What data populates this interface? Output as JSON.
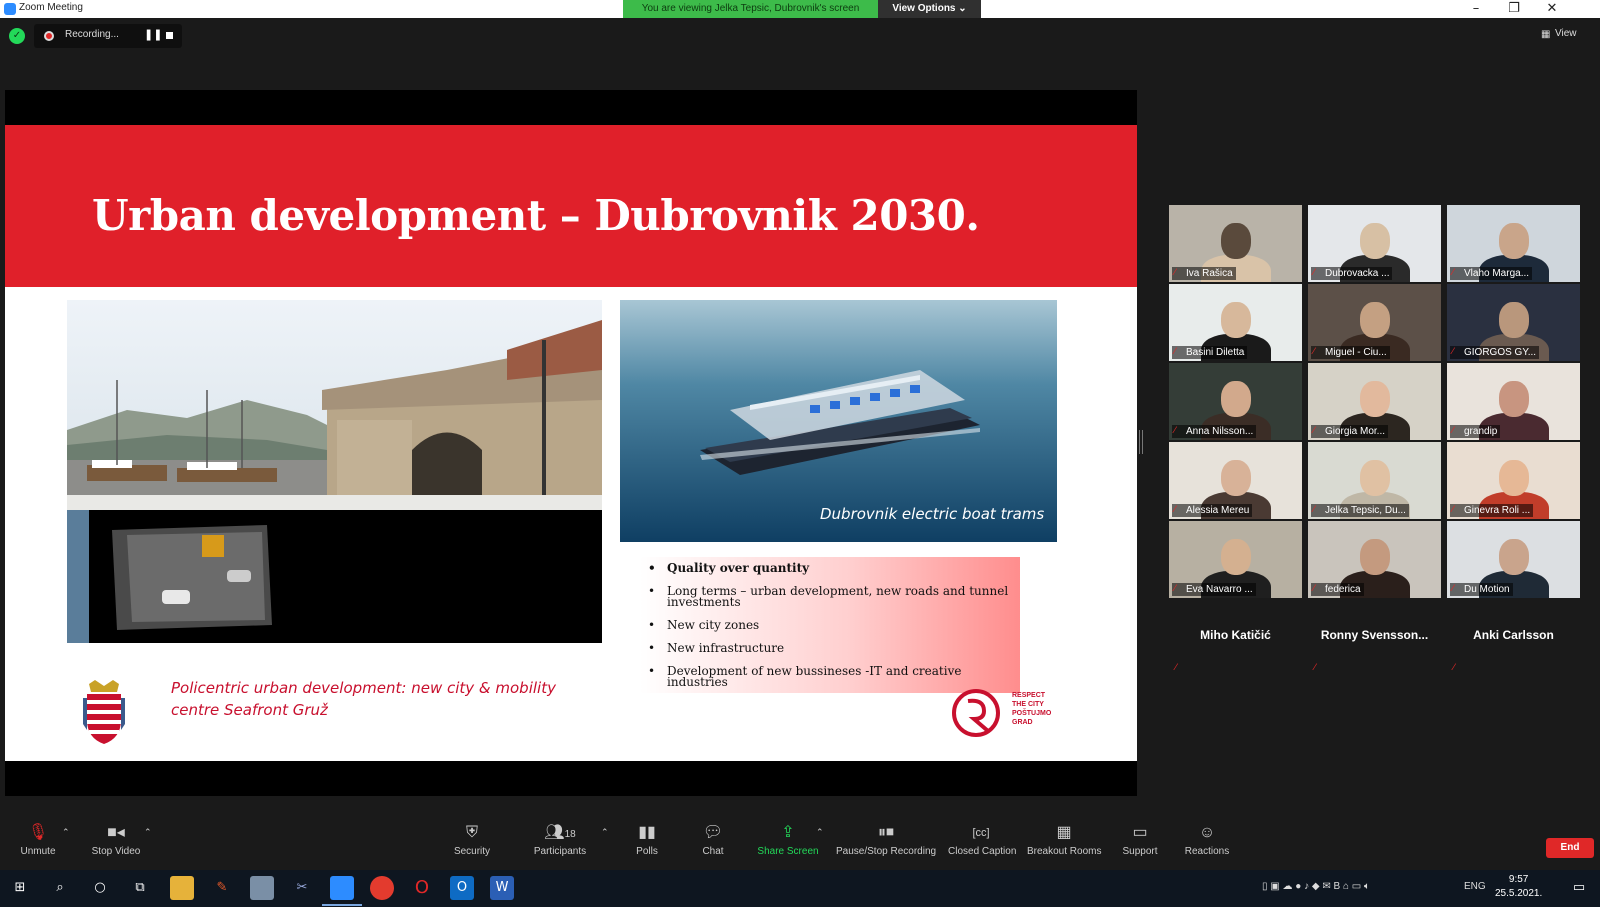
{
  "window": {
    "title": "Zoom Meeting"
  },
  "share": {
    "banner": "You are viewing Jelka Tepsic, Dubrovnik's screen",
    "view_options": "View Options ⌄"
  },
  "recording": {
    "label": "Recording..."
  },
  "view_label": "View",
  "slide": {
    "title": "Urban development – Dubrovnik 2030.",
    "boat_caption": "Dubrovnik electric boat trams",
    "bullets": [
      "Quality over quantity",
      "Long terms – urban development, new roads and tunnel investments",
      "New city zones",
      "New infrastructure",
      "Development of new bussineses -IT and creative industries"
    ],
    "policentric": "Policentric urban development: new city & mobility centre Seafront Gruž",
    "respect_logo": [
      "RESPECT",
      "THE CITY",
      "POŠTUJMO",
      "GRAD"
    ]
  },
  "participants_gallery": [
    {
      "name": "Iva Rašica"
    },
    {
      "name": "Dubrovacka ..."
    },
    {
      "name": "Vlaho Marga..."
    },
    {
      "name": "Basini Diletta"
    },
    {
      "name": "Miguel - Ciu..."
    },
    {
      "name": "GIORGOS GY..."
    },
    {
      "name": "Anna Nilsson..."
    },
    {
      "name": "Giorgia Mor..."
    },
    {
      "name": "grandip"
    },
    {
      "name": "Alessia Mereu"
    },
    {
      "name": "Jelka Tepsic, Du..."
    },
    {
      "name": "Ginevra Roli ..."
    },
    {
      "name": "Eva Navarro ..."
    },
    {
      "name": "federica"
    },
    {
      "name": "Du Motion"
    },
    {
      "name": "Miho Katičić"
    },
    {
      "name": "Ronny  Svensson..."
    },
    {
      "name": "Anki Carlsson"
    }
  ],
  "toolbar": {
    "unmute": "Unmute",
    "stop_video": "Stop Video",
    "security": "Security",
    "participants": "Participants",
    "participants_count": "18",
    "polls": "Polls",
    "chat": "Chat",
    "share_screen": "Share Screen",
    "pause_stop_recording": "Pause/Stop Recording",
    "closed_caption": "Closed Caption",
    "breakout_rooms": "Breakout Rooms",
    "support": "Support",
    "reactions": "Reactions",
    "end": "End"
  },
  "taskbar": {
    "language": "ENG",
    "time": "9:57",
    "date": "25.5.2021."
  },
  "colors": {
    "slide_red": "#e0202a",
    "share_green": "#3dbb4a",
    "end_red": "#e02828",
    "active_speaker": "#d7e84b"
  }
}
